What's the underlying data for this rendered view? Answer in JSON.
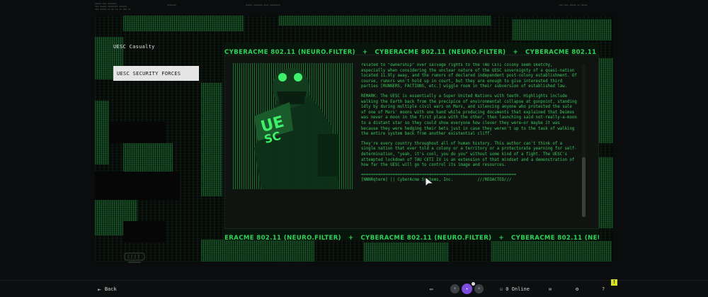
{
  "menu": {
    "casualty_label": "UESC Casualty",
    "security_label": "UESC SECURITY FORCES"
  },
  "ticker": {
    "text": "CYBERACME 802.11 (NEURO.FILTER)",
    "separator": "+",
    "color": "#2fd35a"
  },
  "article": {
    "paragraphs": [
      "related to \"ownership\" over salvage rights to the TAU CETI colony seem sketchy, especially when considering the unclear nature of the UESC sovereignty of a quasi-nation located 11.9ly away, and the rumors of declared independent post-colony establishment. Of course, rumors won't hold up in court, but they are enough to give interested third parties [RUNNERS, FACTIONS, etc.] wiggle room in their subversion of established law.",
      "REMARK: The UESC is essentially a Super United Nations with teeth. Highlights include walking the Earth back from the precipice of environmental collapse at gunpoint, standing idly by during multiple civil wars on Mars, and silencing anyone who protested the sale of one of Mars' moons with one hand while producing documents that explained that Deimos was never a moon in the first place with the other, then launching said not-really-a-moon to a distant star so they could show everyone how clever they were—or maybe it was because they were hedging their bets just in case they weren't up to the task of walking the entire system back from another existential cliff.",
      "They're every country throughout all of human history. This author can't think of a single nation that ever told a colony or a territory or a protectorate yearning for self-determination, \"yeah, it's cool, you do you\" without some kind of a fight. The UESC's attempted lockdown of TAU CETI IV is an extension of that mindset and a demonstration of how far the UESC will go to control its image and resources.",
      "================================================================",
      "[NNNRqterm] || CyberAcme Systems, Inc.          ///REDACTED///"
    ]
  },
  "bottombar": {
    "back_label": "Back",
    "online_label": "0 Online",
    "help_label": "?",
    "notification_label": "!"
  },
  "colors": {
    "accent_green": "#38c75a",
    "selected_bg": "#e5e5e5",
    "notification": "#d6e21f",
    "party_button": "#7c4dde"
  }
}
